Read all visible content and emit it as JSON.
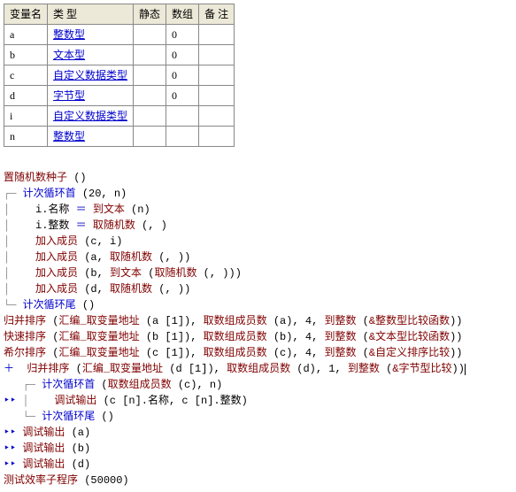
{
  "table": {
    "headers": [
      "变量名",
      "类 型",
      "静态",
      "数组",
      "备 注"
    ],
    "rows": [
      {
        "name": "a",
        "type": "整数型",
        "static": "",
        "array": "0",
        "remark": ""
      },
      {
        "name": "b",
        "type": "文本型",
        "static": "",
        "array": "0",
        "remark": ""
      },
      {
        "name": "c",
        "type": "自定义数据类型",
        "static": "",
        "array": "0",
        "remark": ""
      },
      {
        "name": "d",
        "type": "字节型",
        "static": "",
        "array": "0",
        "remark": ""
      },
      {
        "name": "i",
        "type": "自定义数据类型",
        "static": "",
        "array": "",
        "remark": ""
      },
      {
        "name": "n",
        "type": "整数型",
        "static": "",
        "array": "",
        "remark": ""
      }
    ]
  },
  "code": {
    "l01a": "置随机数种子",
    "l01b": " ()",
    "l02a": "计次循环首",
    "l02b": " (20, n)",
    "l03a": "i.名称 ",
    "l03b": "＝",
    "l03c": " 到文本",
    "l03d": " (n)",
    "l04a": "i.整数 ",
    "l04b": "＝",
    "l04c": " 取随机数",
    "l04d": " (, )",
    "l05a": "加入成员",
    "l05b": " (c, i)",
    "l06a": "加入成员",
    "l06b": " (a, ",
    "l06c": "取随机数",
    "l06d": " (, ))",
    "l07a": "加入成员",
    "l07b": " (b, ",
    "l07c": "到文本",
    "l07d": " (",
    "l07e": "取随机数",
    "l07f": " (, )))",
    "l08a": "加入成员",
    "l08b": " (d, ",
    "l08c": "取随机数",
    "l08d": " (, ))",
    "l09a": "计次循环尾",
    "l09b": " ()",
    "l10a": "归并排序",
    "l10b": " (",
    "l10c": "汇编_取变量地址",
    "l10d": " (a [1]), ",
    "l10e": "取数组成员数",
    "l10f": " (a), 4, ",
    "l10g": "到整数",
    "l10h": " (",
    "l10i": "&整数型比较函数",
    "l10j": "))",
    "l11a": "快速排序",
    "l11b": " (",
    "l11c": "汇编_取变量地址",
    "l11d": " (b [1]), ",
    "l11e": "取数组成员数",
    "l11f": " (b), 4, ",
    "l11g": "到整数",
    "l11h": " (",
    "l11i": "&文本型比较函数",
    "l11j": "))",
    "l12a": "希尔排序",
    "l12b": " (",
    "l12c": "汇编_取变量地址",
    "l12d": " (c [1]), ",
    "l12e": "取数组成员数",
    "l12f": " (c), 4, ",
    "l12g": "到整数",
    "l12h": " (",
    "l12i": "&自定义排序比较",
    "l12j": "))",
    "l13a": "归并排序",
    "l13b": " (",
    "l13c": "汇编_取变量地址",
    "l13d": " (d [1]), ",
    "l13e": "取数组成员数",
    "l13f": " (d), 1, ",
    "l13g": "到整数",
    "l13h": " (",
    "l13i": "&字节型比较",
    "l13j": "))",
    "l14a": "计次循环首",
    "l14b": " (",
    "l14c": "取数组成员数",
    "l14d": " (c), n)",
    "l15a": "调试输出",
    "l15b": " (c [n].名称, c [n].整数)",
    "l16a": "计次循环尾",
    "l16b": " ()",
    "l17a": "调试输出",
    "l17b": " (a)",
    "l18a": "调试输出",
    "l18b": " (b)",
    "l19a": "调试输出",
    "l19b": " (d)",
    "l20a": "测试效率子程序",
    "l20b": " (50000)",
    "plus": "＋",
    "dblarrow": "‣‣"
  }
}
